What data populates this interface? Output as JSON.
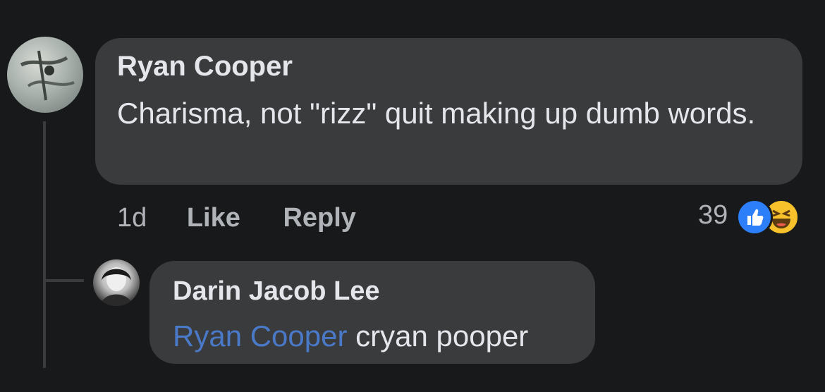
{
  "comment": {
    "author": "Ryan Cooper",
    "text": "Charisma, not \"rizz\" quit making up dumb words.",
    "timestamp": "1d",
    "like_label": "Like",
    "reply_label": "Reply",
    "reaction_count": "39",
    "reaction_icons": [
      "like-icon",
      "haha-icon"
    ]
  },
  "reply": {
    "author": "Darin Jacob Lee",
    "mention": "Ryan Cooper",
    "text": " cryan pooper"
  },
  "colors": {
    "background": "#18191a",
    "bubble": "#3a3b3c",
    "text": "#e4e6eb",
    "secondary_text": "#b0b3b8",
    "mention": "#4a79c8",
    "like_blue": "#2d7ff9",
    "haha_yellow": "#f7c12c"
  }
}
